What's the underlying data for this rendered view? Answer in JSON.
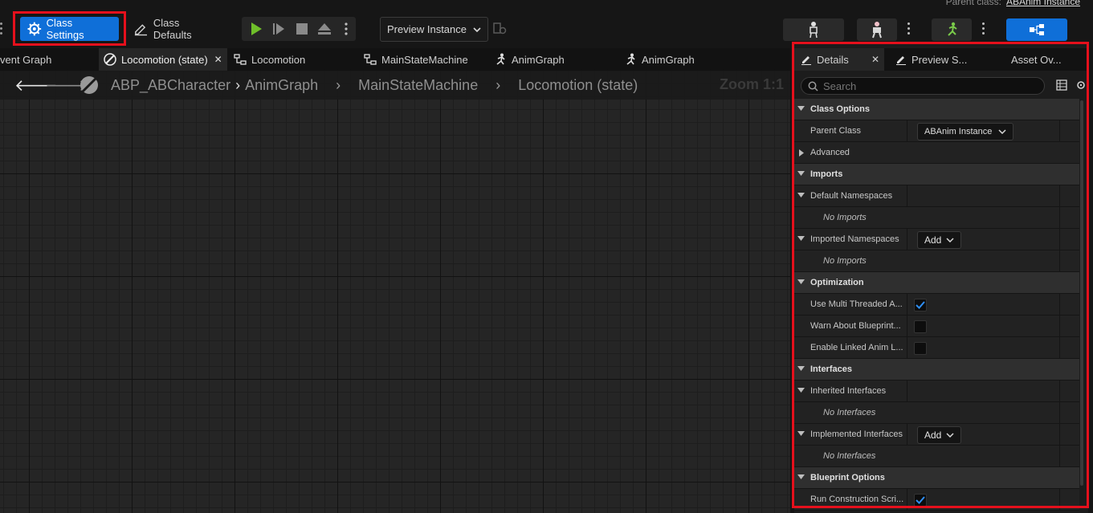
{
  "toolbar": {
    "parent_class_label": "Parent class:",
    "parent_class_value": "ABAnim Instance",
    "class_settings_label": "Class Settings",
    "class_defaults_label": "Class Defaults",
    "preview_instance_label": "Preview Instance"
  },
  "tabs": [
    {
      "label": "vent Graph"
    },
    {
      "label": "Locomotion (state)"
    },
    {
      "label": "Locomotion"
    },
    {
      "label": "MainStateMachine"
    },
    {
      "label": "AnimGraph"
    },
    {
      "label": "AnimGraph"
    }
  ],
  "breadcrumb": {
    "items": [
      "ABP_ABCharacter",
      "AnimGraph",
      "MainStateMachine",
      "Locomotion (state)"
    ],
    "zoom": "Zoom 1:1"
  },
  "panel": {
    "tabs": [
      "Details",
      "Preview S...",
      "Asset Ov..."
    ],
    "search_placeholder": "Search",
    "class_options": "Class Options",
    "parent_class_label": "Parent Class",
    "parent_class_value": "ABAnim Instance",
    "advanced": "Advanced",
    "imports": "Imports",
    "default_namespaces": "Default Namespaces",
    "no_imports_1": "No Imports",
    "imported_namespaces": "Imported Namespaces",
    "add_1": "Add",
    "no_imports_2": "No Imports",
    "optimization": "Optimization",
    "use_multi_threaded": "Use Multi Threaded A...",
    "warn_about_blueprint": "Warn About Blueprint...",
    "enable_linked_anim": "Enable Linked Anim L...",
    "interfaces": "Interfaces",
    "inherited_interfaces": "Inherited Interfaces",
    "no_interfaces_1": "No Interfaces",
    "implemented_interfaces": "Implemented Interfaces",
    "add_2": "Add",
    "no_interfaces_2": "No Interfaces",
    "blueprint_options": "Blueprint Options",
    "run_construction": "Run Construction Scri...",
    "checks": {
      "use_multi_threaded": true,
      "warn_about_blueprint": false,
      "enable_linked_anim": false,
      "run_construction": true
    }
  },
  "colors": {
    "accent": "#0f6fd8",
    "highlight_box": "#e5101c",
    "play": "#6fbf2a"
  }
}
